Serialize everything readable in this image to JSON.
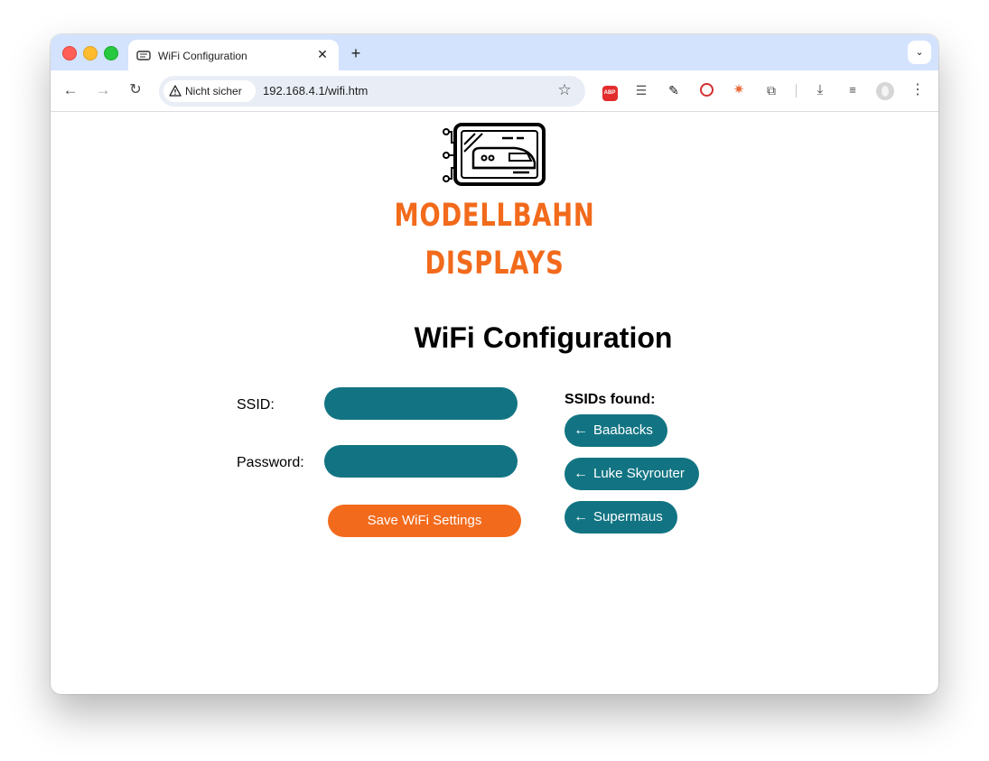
{
  "browser": {
    "tab_title": "WiFi Configuration",
    "tab_close": "✕",
    "new_tab": "+",
    "tab_search": "⌄",
    "security_label": "Nicht sicher",
    "url": "192.168.4.1/wifi.htm",
    "extensions": [
      "abp-icon",
      "lines-icon",
      "eyedropper-icon",
      "no-entry-icon",
      "burst-icon",
      "puzzle-icon",
      "download-icon",
      "queue-music-icon"
    ],
    "abp_label": "ABP"
  },
  "page": {
    "brand_line1": "MODELLBAHN",
    "brand_line2": "DISPLAYS",
    "title": "WiFi Configuration",
    "ssid_label": "SSID:",
    "ssid_value": "",
    "password_label": "Password:",
    "password_value": "",
    "save_button": "Save WiFi Settings",
    "ssids_heading": "SSIDs found:",
    "ssids": [
      {
        "arrow": "←",
        "name": "Baabacks"
      },
      {
        "arrow": "←",
        "name": "Luke Skyrouter"
      },
      {
        "arrow": "←",
        "name": "Supermaus"
      }
    ]
  },
  "colors": {
    "teal": "#127483",
    "orange": "#f26a1b",
    "tabbar": "#d3e3fd"
  }
}
